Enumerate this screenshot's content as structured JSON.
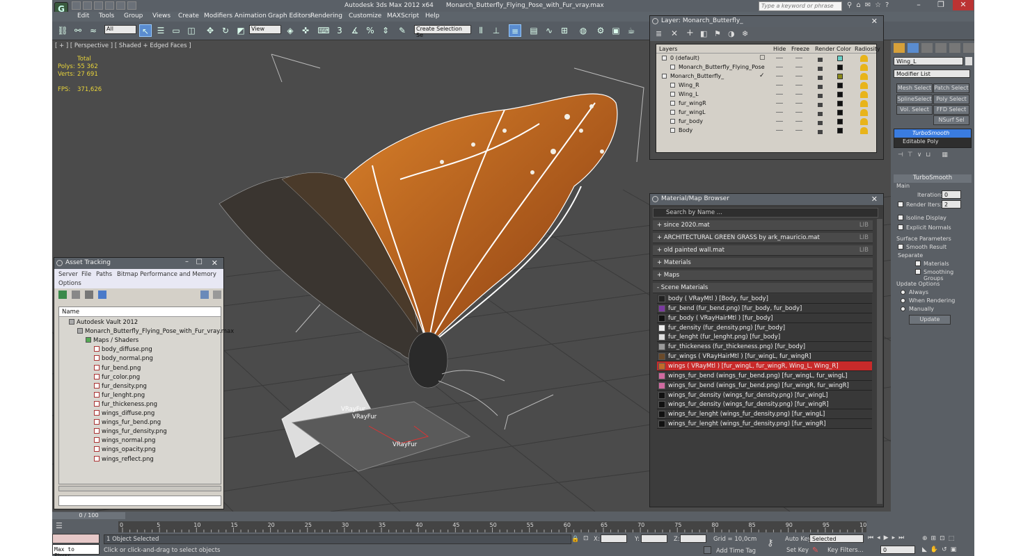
{
  "title": {
    "app": "Autodesk 3ds Max  2012 x64",
    "file": "Monarch_Butterfly_Flying_Pose_with_Fur_vray.max",
    "search_placeholder": "Type a keyword or phrase"
  },
  "menu": [
    "Edit",
    "Tools",
    "Group",
    "Views",
    "Create",
    "Modifiers",
    "Animation",
    "Graph Editors",
    "Rendering",
    "Customize",
    "MAXScript",
    "Help"
  ],
  "toolbar": {
    "selection_filter": "All",
    "reference_coord": "View",
    "named_selection": "Create Selection Se",
    "snap_3": "3",
    "snap_pct": "%"
  },
  "viewport": {
    "label": "[ + ] [ Perspective ] [ Shaded + Edged Faces ]",
    "stats_header": "Total",
    "polys_label": "Polys:",
    "polys_value": "55 362",
    "verts_label": "Verts:",
    "verts_value": "27 691",
    "fps_label": "FPS:",
    "fps_value": "371,626",
    "fur_labels": [
      "VRayFur",
      "VRayFur",
      "VRayFur"
    ]
  },
  "layer_panel": {
    "title": "Layer: Monarch_Butterfly_",
    "columns": [
      "Layers",
      "Hide",
      "Freeze",
      "Render",
      "Color",
      "Radiosity"
    ],
    "rows": [
      {
        "name": "0 (default)",
        "indent": 0,
        "color": "#6ad0c8",
        "check": "box"
      },
      {
        "name": "Monarch_Butterfly_Flying_Pose",
        "indent": 1,
        "color": "#111111",
        "check": ""
      },
      {
        "name": "Monarch_Butterfly_",
        "indent": 0,
        "color": "#8a8a1a",
        "check": "tick"
      },
      {
        "name": "Wing_R",
        "indent": 1,
        "color": "#111111",
        "check": ""
      },
      {
        "name": "Wing_L",
        "indent": 1,
        "color": "#111111",
        "check": ""
      },
      {
        "name": "fur_wingR",
        "indent": 1,
        "color": "#111111",
        "check": ""
      },
      {
        "name": "fur_wingL",
        "indent": 1,
        "color": "#111111",
        "check": ""
      },
      {
        "name": "fur_body",
        "indent": 1,
        "color": "#111111",
        "check": ""
      },
      {
        "name": "Body",
        "indent": 1,
        "color": "#111111",
        "check": ""
      }
    ]
  },
  "material_browser": {
    "title": "Material/Map Browser",
    "search_placeholder": "Search by Name ...",
    "libs": [
      {
        "label": "+ since 2020.mat",
        "tag": "LIB"
      },
      {
        "label": "+ ARCHITECTURAL GREEN GRASS by ark_mauricio.mat",
        "tag": "LIB"
      },
      {
        "label": "+ old painted wall.mat",
        "tag": "LIB"
      },
      {
        "label": "+ Materials",
        "tag": ""
      },
      {
        "label": "+ Maps",
        "tag": ""
      },
      {
        "label": "- Scene Materials",
        "tag": ""
      }
    ],
    "scene_materials": [
      {
        "text": "body  ( VRayMtl )  [Body, fur_body]",
        "swatch": "#222222"
      },
      {
        "text": "fur_bend (fur_bend.png)  [fur_body, fur_body]",
        "swatch": "#7a3aa0"
      },
      {
        "text": "fur_body  ( VRayHairMtl )  [fur_body]",
        "swatch": "#111111"
      },
      {
        "text": "fur_density (fur_density.png)  [fur_body]",
        "swatch": "#eeeeee"
      },
      {
        "text": "fur_lenght (fur_lenght.png)  [fur_body]",
        "swatch": "#dddddd"
      },
      {
        "text": "fur_thickeness (fur_thickeness.png)  [fur_body]",
        "swatch": "#9a9a9a"
      },
      {
        "text": "fur_wings  ( VRayHairMtl )  [fur_wingL, fur_wingR]",
        "swatch": "#6a4a2a"
      },
      {
        "text": "wings  ( VRayMtl )  [fur_wingL, fur_wingR, Wing_L, Wing_R]",
        "swatch": "#c06a2a",
        "selected": true
      },
      {
        "text": "wings_fur_bend (wings_fur_bend.png)  [fur_wingL, fur_wingL]",
        "swatch": "#d06aa0"
      },
      {
        "text": "wings_fur_bend (wings_fur_bend.png)  [fur_wingR, fur_wingR]",
        "swatch": "#d06aa0"
      },
      {
        "text": "wings_fur_density (wings_fur_density.png)  [fur_wingL]",
        "swatch": "#111111"
      },
      {
        "text": "wings_fur_density (wings_fur_density.png)  [fur_wingR]",
        "swatch": "#111111"
      },
      {
        "text": "wings_fur_lenght (wings_fur_density.png)  [fur_wingL]",
        "swatch": "#111111"
      },
      {
        "text": "wings_fur_lenght (wings_fur_density.png)  [fur_wingR]",
        "swatch": "#111111"
      }
    ]
  },
  "asset_tracking": {
    "title": "Asset Tracking",
    "menu": [
      "Server",
      "File",
      "Paths",
      "Bitmap Performance and Memory",
      "Options"
    ],
    "column": "Name",
    "items": [
      {
        "name": "Autodesk Vault 2012",
        "level": 0
      },
      {
        "name": "Monarch_Butterfly_Flying_Pose_with_Fur_vray.max",
        "level": 1
      },
      {
        "name": "Maps / Shaders",
        "level": 2
      },
      {
        "name": "body_diffuse.png",
        "level": 3
      },
      {
        "name": "body_normal.png",
        "level": 3
      },
      {
        "name": "fur_bend.png",
        "level": 3
      },
      {
        "name": "fur_color.png",
        "level": 3
      },
      {
        "name": "fur_density.png",
        "level": 3
      },
      {
        "name": "fur_lenght.png",
        "level": 3
      },
      {
        "name": "fur_thickeness.png",
        "level": 3
      },
      {
        "name": "wings_diffuse.png",
        "level": 3
      },
      {
        "name": "wings_fur_bend.png",
        "level": 3
      },
      {
        "name": "wings_fur_density.png",
        "level": 3
      },
      {
        "name": "wings_normal.png",
        "level": 3
      },
      {
        "name": "wings_opacity.png",
        "level": 3
      },
      {
        "name": "wings_reflect.png",
        "level": 3
      }
    ]
  },
  "command_panel": {
    "object_name": "Wing_L",
    "modifier_list": "Modifier List",
    "buttons": [
      "Mesh Select",
      "Patch Select",
      "SplineSelect",
      "Poly Select",
      "Vol. Select",
      "FFD Select",
      "NSurf Sel"
    ],
    "stack": [
      "TurboSmooth",
      "Editable Poly"
    ],
    "rollout": "TurboSmooth",
    "main": "Main",
    "iterations_label": "Iterations:",
    "iterations_value": "0",
    "render_iters_label": "Render Iters:",
    "render_iters_value": "2",
    "isoline": "Isoline Display",
    "explicit": "Explicit Normals",
    "surface_params": "Surface Parameters",
    "smooth_result": "Smooth Result",
    "separate": "Separate",
    "materials": "Materials",
    "smoothing_groups": "Smoothing Groups",
    "update_options": "Update Options",
    "always": "Always",
    "when_rendering": "When Rendering",
    "manually": "Manually",
    "update": "Update"
  },
  "timeline": {
    "frame": "0 / 100",
    "ticks": [
      "0",
      "5",
      "10",
      "15",
      "20",
      "25",
      "30",
      "35",
      "40",
      "45",
      "50",
      "55",
      "60",
      "65",
      "70",
      "75",
      "80",
      "85",
      "90",
      "95",
      "100"
    ]
  },
  "status": {
    "listener": "Max to Physc.",
    "selected": "1 Object Selected",
    "prompt": "Click or click-and-drag to select objects",
    "x_label": "X:",
    "y_label": "Y:",
    "z_label": "Z:",
    "grid": "Grid = 10,0cm",
    "add_time_tag": "Add Time Tag",
    "auto_key": "Auto Key",
    "set_key": "Set Key",
    "selected_dd": "Selected",
    "key_filters": "Key Filters...",
    "frame_value": "0"
  }
}
